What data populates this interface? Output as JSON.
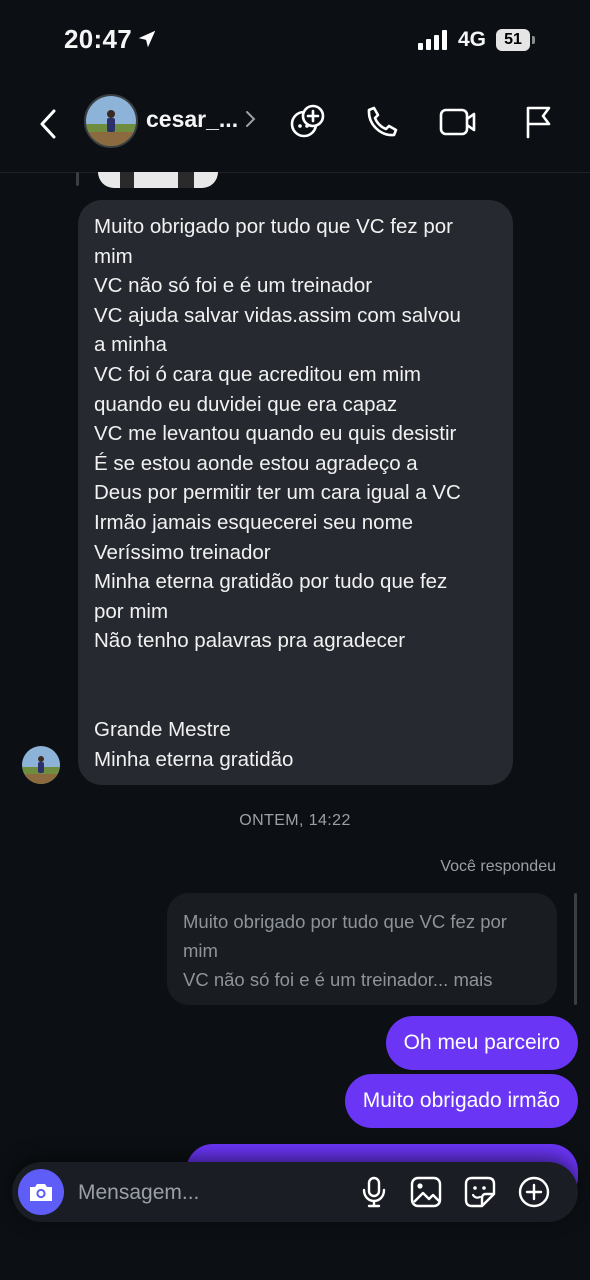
{
  "status_bar": {
    "time": "20:47",
    "network": "4G",
    "battery": "51"
  },
  "header": {
    "username": "cesar_..."
  },
  "incoming_message": {
    "lines": [
      "Muito obrigado por tudo que VC fez por",
      "mim",
      "VC não só foi e é um treinador",
      "VC ajuda salvar vidas.assim com salvou",
      "a minha",
      "VC foi ó cara que acreditou em mim",
      "quando eu duvidei que era capaz",
      "VC me levantou quando eu quis desistir",
      "É se estou aonde estou agradeço a",
      "Deus por permitir ter um cara igual a VC",
      "Irmão jamais esquecerei seu nome",
      "Veríssimo treinador",
      "Minha eterna gratidão por tudo que fez",
      "por mim",
      "Não tenho palavras pra agradecer",
      "",
      "",
      "Grande Mestre",
      "Minha eterna gratidão"
    ]
  },
  "timestamp": "ONTEM, 14:22",
  "reply_label": "Você respondeu",
  "quoted_reply": {
    "line1": "Muito obrigado por tudo que VC fez por",
    "line2": "mim",
    "line3": "VC não só foi e é um treinador... mais"
  },
  "outgoing_messages": [
    "Oh meu parceiro",
    "Muito obrigado irmão",
    ""
  ],
  "composer": {
    "placeholder": "Mensagem..."
  },
  "colors": {
    "background": "#0c1014",
    "incoming_bubble": "#262a30",
    "outgoing_bubble": "#6a35f5",
    "camera_button": "#5f5df8"
  }
}
